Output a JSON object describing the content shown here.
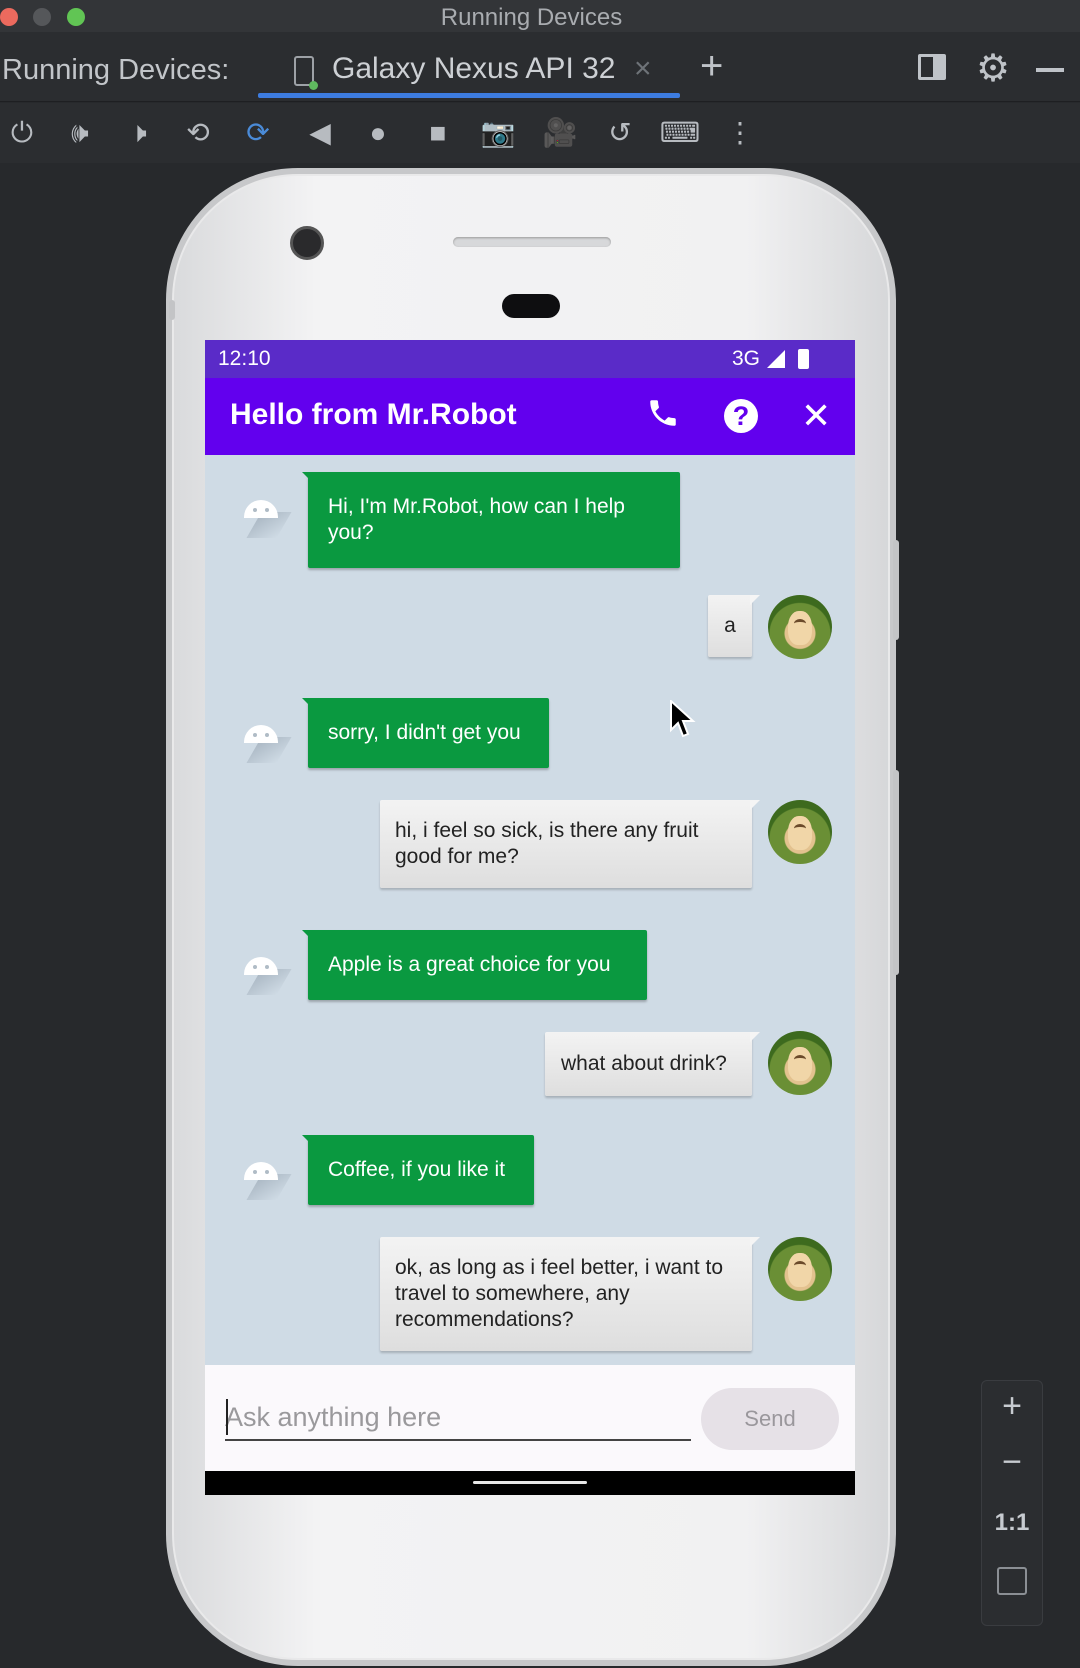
{
  "window": {
    "title": "Running Devices"
  },
  "tabbar": {
    "label": "Running Devices:",
    "tab_label": "Galaxy Nexus API 32",
    "tab_close": "×",
    "add": "+"
  },
  "toolbar": {
    "items": [
      "power",
      "volume-up",
      "volume-down",
      "rotate-left",
      "rotate-right",
      "back",
      "home",
      "overview",
      "screenshot",
      "screen-record",
      "reset",
      "keyboard",
      "more"
    ]
  },
  "zoom": {
    "in": "+",
    "out": "−",
    "actual": "1:1"
  },
  "phone": {
    "status": {
      "time": "12:10",
      "network": "3G"
    },
    "appbar": {
      "title": "Hello from Mr.Robot",
      "help": "?",
      "close": "✕",
      "call": "✆"
    },
    "messages": [
      {
        "from": "bot",
        "text": "Hi, I'm Mr.Robot, how can I help you?"
      },
      {
        "from": "user",
        "text": "a"
      },
      {
        "from": "bot",
        "text": "sorry, I didn't get you"
      },
      {
        "from": "user",
        "text": "hi, i feel so sick, is there any fruit good for me?"
      },
      {
        "from": "bot",
        "text": "Apple is a great choice for you"
      },
      {
        "from": "user",
        "text": "what about drink?"
      },
      {
        "from": "bot",
        "text": "Coffee, if you like it"
      },
      {
        "from": "user",
        "text": "ok, as long as i feel better, i want to travel to somewhere, any recommendations?"
      }
    ],
    "input": {
      "placeholder": "Ask anything here",
      "value": ""
    },
    "send_label": "Send"
  },
  "colors": {
    "appbar": "#6200ee",
    "statusbar": "#5a2bc8",
    "bot_bubble": "#0a9940",
    "screen_bg": "#cfdbe5",
    "tab_accent": "#3d7ce0"
  }
}
